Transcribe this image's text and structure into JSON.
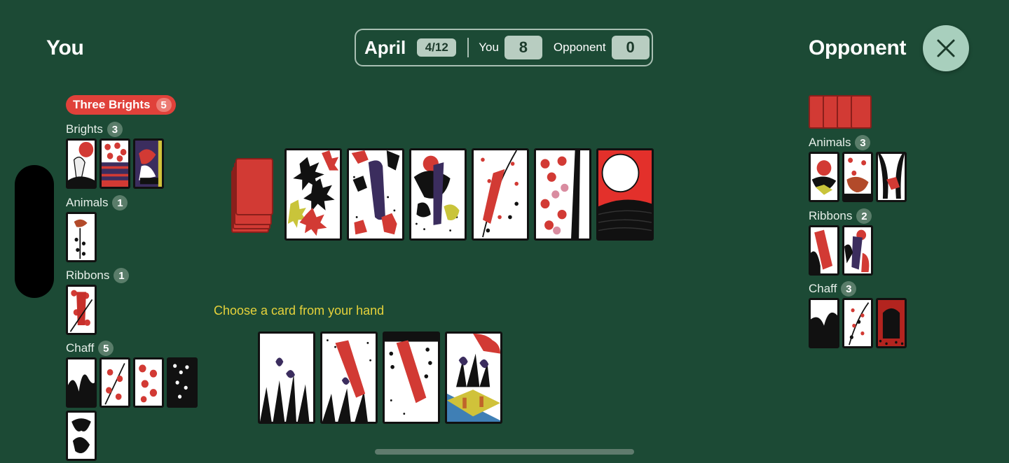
{
  "players": {
    "you": "You",
    "opponent": "Opponent"
  },
  "scorebar": {
    "month": "April",
    "round": "4/12",
    "you_label": "You",
    "you_score": "8",
    "opp_label": "Opponent",
    "opp_score": "0"
  },
  "yaku": {
    "label": "Three Brights",
    "points": "5"
  },
  "you_groups": {
    "brights": {
      "label": "Brights",
      "count": "3"
    },
    "animals": {
      "label": "Animals",
      "count": "1"
    },
    "ribbons": {
      "label": "Ribbons",
      "count": "1"
    },
    "chaff": {
      "label": "Chaff",
      "count": "5"
    }
  },
  "opp_groups": {
    "animals": {
      "label": "Animals",
      "count": "3"
    },
    "ribbons": {
      "label": "Ribbons",
      "count": "2"
    },
    "chaff": {
      "label": "Chaff",
      "count": "3"
    }
  },
  "prompt": "Choose a card from your hand",
  "table_cards": [
    "maple-chaff",
    "maple-ribbon",
    "chrysanthemum-ribbon",
    "bushclover-ribbon",
    "cherry-chaff",
    "pampas-moon"
  ],
  "hand_cards": [
    "iris-chaff",
    "iris-ribbon",
    "wisteria-ribbon",
    "iris-bridge"
  ],
  "colors": {
    "felt": "#1c4a35",
    "card_red": "#d23a34",
    "accent_yellow": "#e6d23b",
    "yaku_red": "#e0413a"
  },
  "icons": {
    "close": "close-icon"
  }
}
